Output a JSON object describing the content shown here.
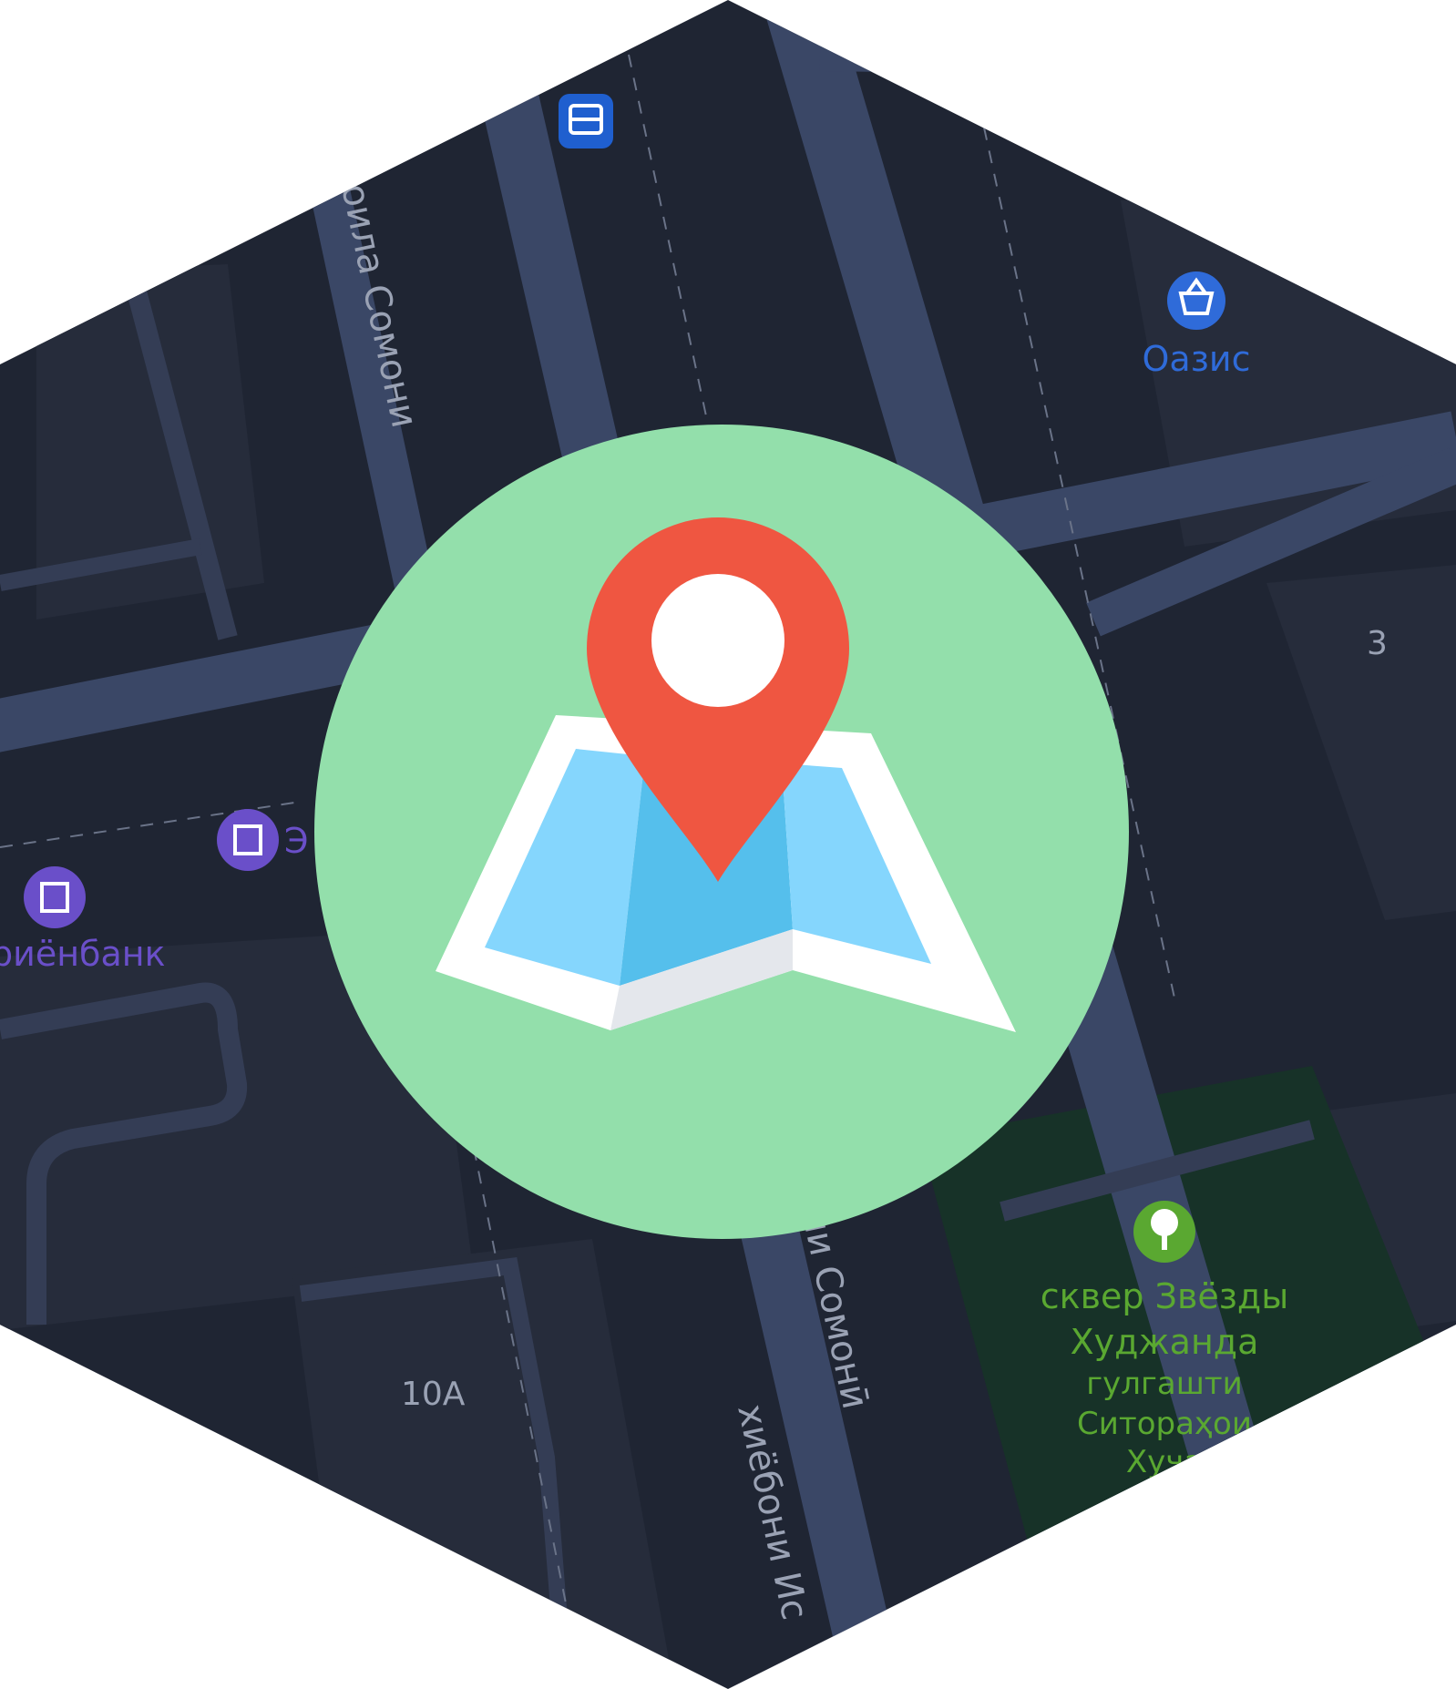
{
  "colors": {
    "background": "#ffffff",
    "map_ground": "#1f2533",
    "block": "#262c3b",
    "road_main": "#3a4766",
    "road_minor": "#343d55",
    "park": "#173228",
    "street_text": "#9aa2b4",
    "badge_circle": "#93dfab",
    "pin": "#ef5641",
    "map_light": "#85d6fd",
    "map_mid": "#55bfec",
    "map_paper": "#ffffff",
    "map_fold_shadow": "#e4e7ec",
    "poi_bank": "#6a4fc9",
    "poi_shop": "#2f6bd9",
    "poi_park": "#5aa831",
    "poi_transit": "#1f5fcf"
  },
  "map": {
    "streets": {
      "upper": "оила Сомони",
      "lower_center": "ли Сомонӣ",
      "lower_left": "хиёбони Ис"
    },
    "buildings": {
      "b1": "3",
      "b2": "10А"
    },
    "pois": {
      "shop": {
        "label": "Оазис",
        "icon": "basket-icon"
      },
      "bank_left": {
        "label": "риёнбанк",
        "icon": "bank-icon"
      },
      "bank_center": {
        "label": "Э",
        "icon": "bank-icon"
      },
      "park": {
        "line1": "сквер Звёзды",
        "line2": "Худжанда",
        "line3": "гулгашти",
        "line4": "Ситораҳои",
        "line5": "Хуҷа",
        "icon": "tree-icon"
      },
      "transit": {
        "icon": "bus-stop-icon"
      }
    }
  },
  "badge": {
    "icon": "map-pin-icon"
  }
}
